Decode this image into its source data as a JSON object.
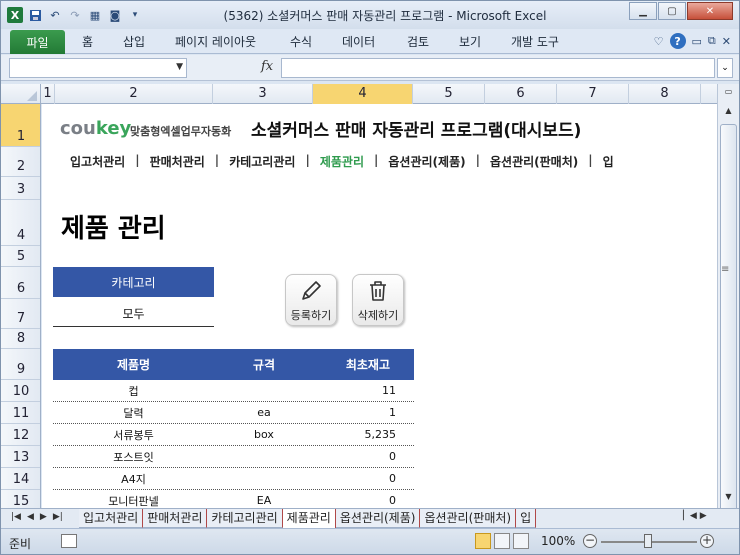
{
  "window": {
    "title": "(5362) 소셜커머스 판매 자동관리 프로그램 - Microsoft Excel",
    "qat_icons": [
      "excel-logo",
      "save-icon",
      "undo-icon",
      "redo-icon",
      "form-icon",
      "camera-icon",
      "customize-icon"
    ]
  },
  "ribbon": {
    "file_tab": "파일",
    "tabs": [
      "홈",
      "삽입",
      "페이지 레이아웃",
      "수식",
      "데이터",
      "검토",
      "보기",
      "개발 도구"
    ]
  },
  "formula_bar": {
    "name_box": "",
    "fx_label": "fx",
    "formula": ""
  },
  "grid": {
    "columns": [
      "1",
      "2",
      "3",
      "4",
      "5",
      "6",
      "7",
      "8"
    ],
    "rows": [
      "1",
      "2",
      "3",
      "4",
      "5",
      "6",
      "7",
      "8",
      "9",
      "10",
      "11",
      "12",
      "13",
      "14",
      "15",
      "16"
    ]
  },
  "sheet": {
    "brand_cou": "cou",
    "brand_key": "key",
    "brand_sub": "맞춤형엑셀업무자동화",
    "heading": "소셜커머스 판매 자동관리 프로그램(대시보드)",
    "nav": [
      "입고처관리",
      "판매처관리",
      "카테고리관리",
      "제품관리",
      "옵션관리(제품)",
      "옵션관리(판매처)",
      "입"
    ],
    "nav_active": "제품관리",
    "section_title": "제품 관리",
    "category_label": "카테고리",
    "category_value": "모두",
    "register_label": "등록하기",
    "delete_label": "삭제하기",
    "table": {
      "headers": [
        "제품명",
        "규격",
        "최초재고"
      ],
      "rows": [
        [
          "컵",
          "",
          "11"
        ],
        [
          "달력",
          "ea",
          "1"
        ],
        [
          "서류봉투",
          "box",
          "5,235"
        ],
        [
          "포스트잇",
          "",
          "0"
        ],
        [
          "A4지",
          "",
          "0"
        ],
        [
          "모니터판넬",
          "EA",
          "0"
        ]
      ]
    }
  },
  "sheet_tabs": [
    "입고처관리",
    "판매처관리",
    "카테고리관리",
    "제품관리",
    "옵션관리(제품)",
    "옵션관리(판매처)",
    "입"
  ],
  "active_sheet_tab": "제품관리",
  "status": {
    "ready": "준비",
    "zoom": "100%"
  },
  "colors": {
    "accent_blue": "#3457a6",
    "active_green": "#2f9b4e",
    "selection_yellow": "#f7d571"
  }
}
